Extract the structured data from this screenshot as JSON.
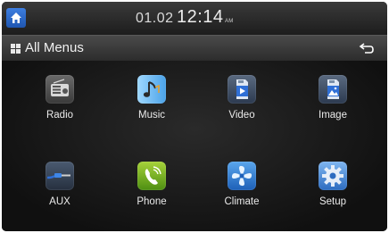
{
  "status": {
    "date": "01.02",
    "time": "12:14",
    "ampm": "AM"
  },
  "header": {
    "title": "All Menus"
  },
  "menu": [
    {
      "label": "Radio",
      "icon": "radio-icon"
    },
    {
      "label": "Music",
      "icon": "music-icon"
    },
    {
      "label": "Video",
      "icon": "video-icon"
    },
    {
      "label": "Image",
      "icon": "image-icon"
    },
    {
      "label": "AUX",
      "icon": "aux-cable-icon"
    },
    {
      "label": "Phone",
      "icon": "phone-icon"
    },
    {
      "label": "Climate",
      "icon": "fan-icon"
    },
    {
      "label": "Setup",
      "icon": "gear-icon"
    }
  ],
  "colors": {
    "accent": "#2f6fd6",
    "background": "#151515",
    "text": "#eaeaea"
  }
}
